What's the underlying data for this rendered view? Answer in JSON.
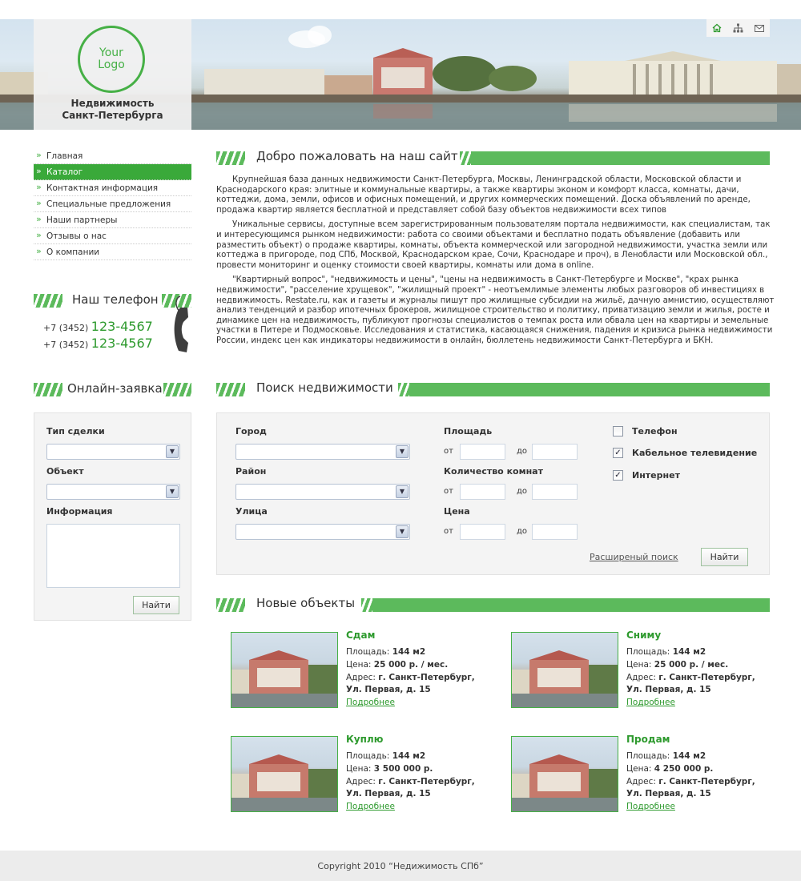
{
  "header": {
    "logo_text": "Your\nLogo",
    "site_name": "Недвижимость\nСанкт-Петербурга",
    "icons": [
      "home-icon",
      "sitemap-icon",
      "mail-icon"
    ]
  },
  "menu": [
    {
      "label": "Главная",
      "active": false
    },
    {
      "label": "Каталог",
      "active": true
    },
    {
      "label": "Контактная информация",
      "active": false
    },
    {
      "label": "Специальные предложения",
      "active": false
    },
    {
      "label": "Наши партнеры",
      "active": false
    },
    {
      "label": "Отзывы о нас",
      "active": false
    },
    {
      "label": "О компании",
      "active": false
    }
  ],
  "phone_block": {
    "title": "Наш телефон",
    "phones": [
      {
        "code": "+7 (3452)",
        "number": "123-4567"
      },
      {
        "code": "+7 (3452)",
        "number": "123-4567"
      }
    ]
  },
  "order": {
    "title": "Онлайн-заявка",
    "deal_label": "Тип сделки",
    "object_label": "Объект",
    "info_label": "Информация",
    "submit": "Найти"
  },
  "welcome": {
    "title": "Добро пожаловать на наш сайт",
    "paragraphs": [
      "Крупнейшая база данных недвижимости Санкт-Петербурга, Москвы, Ленинградской области, Московской области и Краснодарского края: элитные и коммунальные квартиры, а также квартиры эконом и комфорт класса, комнаты, дачи, коттеджи, дома, земли, офисов и офисных помещений, и других коммерческих помещений. Доска объявлений по аренде, продажа квартир является бесплатной и представляет собой базу объектов недвижимости всех типов",
      "Уникальные сервисы, доступные всем зарегистрированным пользователям портала недвижимости, как специалистам, так и интересующимся рынком недвижимости: работа со своими объектами и бесплатно подать объявление (добавить или разместить объект) о продаже квартиры, комнаты, объекта коммерческой или загородной недвижимости, участка земли или коттеджа в пригороде, под СПб, Москвой, Краснодарском крае, Сочи, Краснодаре и проч), в Ленобласти или Московской обл., провести мониторинг и оценку стоимости своей квартиры, комнаты или дома в online.",
      "\"Квартирный вопрос\", \"недвижимость и цены\", \"цены на недвижимость в Санкт-Петербурге и Москве\", \"крах рынка недвижимости\", \"расселение хрущевок\", \"жилищный проект\" - неотъемлимые элементы любых разговоров об инвестициях в недвижимость. Restate.ru, как и газеты и журналы пишут про жилищные субсидии на жильё, дачную амнистию, осуществляют анализ тенденций и разбор ипотечных брокеров, жилищное строительство и политику, приватизацию земли и жилья, росте и динамике цен на недвижимость, публикуют прогнозы специалистов о темпах роста или обвала цен на квартиры и земельные участки в Питере и Подмосковье. Исследования и статистика, касающаяся снижения, падения и кризиса рынка недвижимости России, индекс цен как индикаторы недвижимости в онлайн, бюллетень недвижимости Санкт-Петербурга и БКН."
    ]
  },
  "search": {
    "title": "Поиск недвижимости",
    "city_label": "Город",
    "district_label": "Район",
    "street_label": "Улица",
    "area_label": "Площадь",
    "rooms_label": "Количество комнат",
    "price_label": "Цена",
    "from": "от",
    "to": "до",
    "phone_cb": {
      "label": "Телефон",
      "checked": false
    },
    "tv_cb": {
      "label": "Кабельное телевидение",
      "checked": true
    },
    "internet_cb": {
      "label": "Интернет",
      "checked": true
    },
    "advanced_link": "Расширеный поиск",
    "submit": "Найти"
  },
  "new_objects": {
    "title": "Новые объекты",
    "area_prefix": "Площадь:",
    "price_prefix": "Цена:",
    "address_prefix": "Адрес:",
    "more": "Подробнее",
    "items": [
      {
        "title": "Сдам",
        "area": "144 м2",
        "price": "25 000 р. / мес.",
        "address1": "г. Санкт-Петербург,",
        "address2": "Ул. Первая, д. 15"
      },
      {
        "title": "Сниму",
        "area": "144 м2",
        "price": "25 000 р. / мес.",
        "address1": "г. Санкт-Петербург,",
        "address2": "Ул. Первая, д. 15"
      },
      {
        "title": "Куплю",
        "area": "144 м2",
        "price": "3 500 000 р.",
        "address1": "г. Санкт-Петербург,",
        "address2": "Ул. Первая, д. 15"
      },
      {
        "title": "Продам",
        "area": "144 м2",
        "price": "4 250 000 р.",
        "address1": "г. Санкт-Петербург,",
        "address2": "Ул. Первая, д. 15"
      }
    ]
  },
  "footer": {
    "copyright": "Copyright 2010 “Недижимость СПб”"
  },
  "colors": {
    "accent": "#46b046",
    "accent_dark": "#2e9a2e",
    "panel": "#f4f4f4"
  }
}
